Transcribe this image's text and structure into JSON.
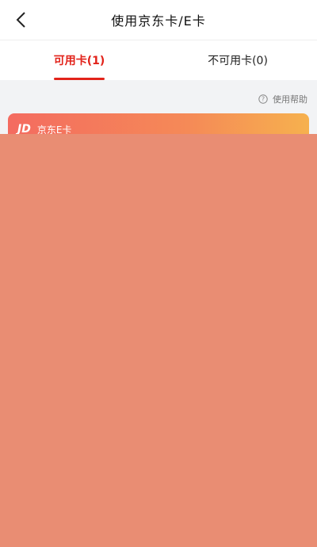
{
  "header": {
    "title": "使用京东卡/E卡"
  },
  "tabs": [
    {
      "label": "可用卡(1)"
    },
    {
      "label": "不可用卡(0)"
    }
  ],
  "help": {
    "label": "使用帮助"
  },
  "card": {
    "logo": "JD",
    "label": "京东E卡"
  },
  "colors": {
    "accent": "#e2231a",
    "overlay": "#e98d73"
  }
}
